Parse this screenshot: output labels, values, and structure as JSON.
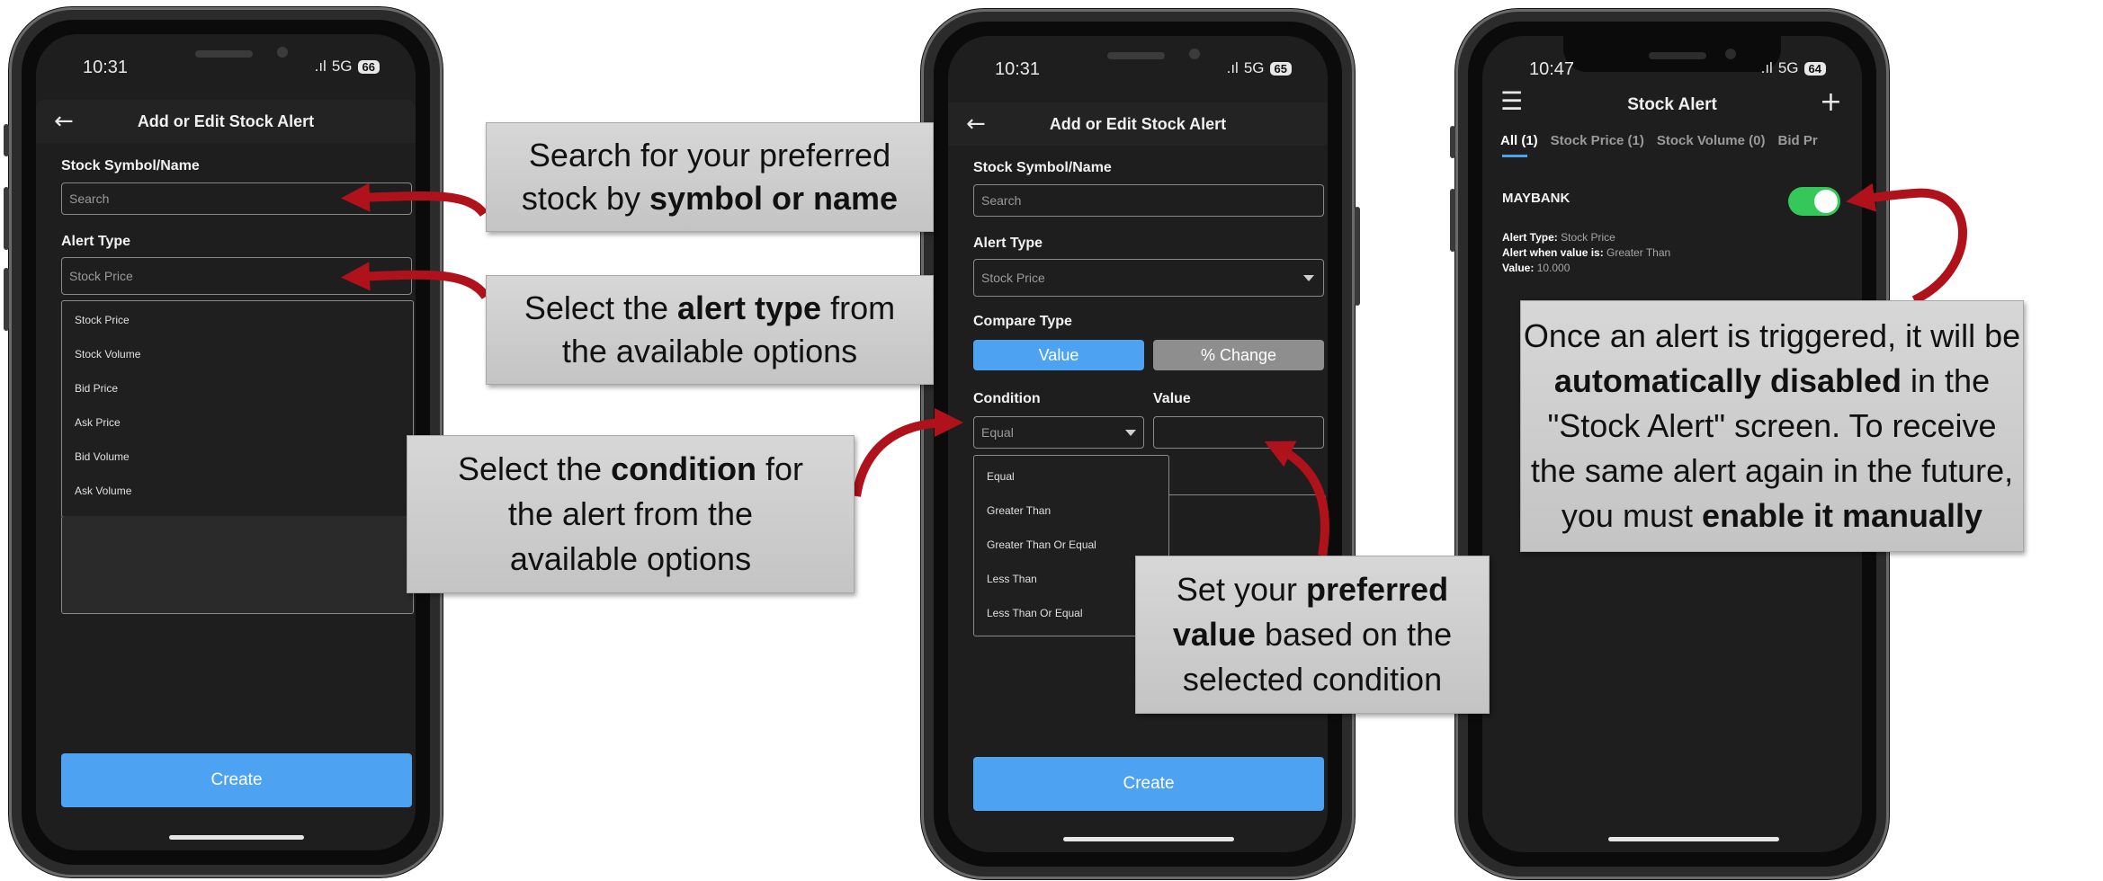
{
  "phones": {
    "status_time_1": "10:31",
    "status_time_2": "10:31",
    "status_time_3": "10:47",
    "network": "5G",
    "battery_1": "66",
    "battery_2": "65",
    "battery_3": "64"
  },
  "form": {
    "title": "Add or Edit Stock Alert",
    "symbol_label": "Stock Symbol/Name",
    "search_placeholder": "Search",
    "alert_type_label": "Alert Type",
    "alert_type_value": "Stock Price",
    "alert_type_options": [
      "Stock Price",
      "Stock Volume",
      "Bid Price",
      "Ask Price",
      "Bid Volume",
      "Ask Volume"
    ],
    "compare_type_label": "Compare Type",
    "compare_value": "Value",
    "compare_change": "% Change",
    "condition_label": "Condition",
    "condition_value": "Equal",
    "value_label": "Value",
    "condition_options": [
      "Equal",
      "Greater Than",
      "Greater Than Or Equal",
      "Less Than",
      "Less Than Or Equal"
    ],
    "create_button": "Create"
  },
  "alerts_screen": {
    "title": "Stock Alert",
    "tabs": [
      "All (1)",
      "Stock Price (1)",
      "Stock Volume (0)",
      "Bid Pr"
    ],
    "item_name": "MAYBANK",
    "alert_type_key": "Alert Type:",
    "alert_type_val": "Stock Price",
    "alert_when_key": "Alert when value is:",
    "alert_when_val": "Greater Than",
    "value_key": "Value:",
    "value_val": "10.000",
    "toggle_on": true
  },
  "callouts": {
    "c1": {
      "t1": "Search for your preferred",
      "t2a": "stock by ",
      "t2b": "symbol or name"
    },
    "c2": {
      "t1a": "Select the ",
      "t1b": "alert type",
      "t1c": " from",
      "t2": "the available options"
    },
    "c3": {
      "t1a": "Select the ",
      "t1b": "condition",
      "t1c": " for",
      "t2": "the alert from the",
      "t3": "available options"
    },
    "c4": {
      "t1a": "Set your ",
      "t1b": "preferred",
      "t2a": "value",
      "t2b": " based on the",
      "t3": "selected condition"
    },
    "c5": {
      "t1": "Once an alert is triggered, it will be",
      "t2a": "automatically disabled",
      "t2b": " in the",
      "t3": "\"Stock Alert\" screen. To receive",
      "t4": "the same alert again in the future,",
      "t5a": "you must ",
      "t5b": "enable it manually"
    }
  },
  "colors": {
    "accent": "#4da3f2",
    "toggle": "#34c759",
    "arrow": "#b0121b"
  }
}
